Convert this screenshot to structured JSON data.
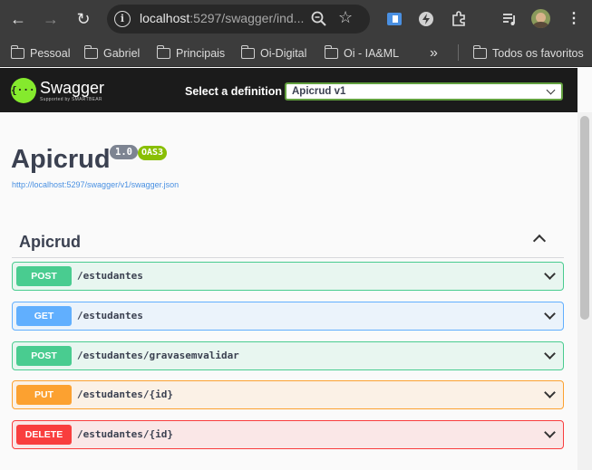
{
  "browser": {
    "url_host": "localhost",
    "url_rest": ":5297/swagger/ind...",
    "bookmarks": [
      {
        "label": "Pessoal"
      },
      {
        "label": "Gabriel"
      },
      {
        "label": "Principais"
      },
      {
        "label": "Oi-Digital"
      },
      {
        "label": "Oi - IA&ML"
      }
    ],
    "overflow_label": "»",
    "all_bookmarks_label": "Todos os favoritos"
  },
  "swagger": {
    "logo_text": "Swagger",
    "logo_sub": "Supported by SMARTBEAR",
    "logo_glyph": "{···}",
    "definition_label": "Select a definition",
    "definition_selected": "Apicrud v1"
  },
  "info": {
    "title": "Apicrud",
    "version": "1.0",
    "oas": "OAS3",
    "spec_url": "http://localhost:5297/swagger/v1/swagger.json"
  },
  "tag": {
    "name": "Apicrud"
  },
  "operations": [
    {
      "method": "POST",
      "path": "/estudantes"
    },
    {
      "method": "GET",
      "path": "/estudantes"
    },
    {
      "method": "POST",
      "path": "/estudantes/gravasemvalidar"
    },
    {
      "method": "PUT",
      "path": "/estudantes/{id}"
    },
    {
      "method": "DELETE",
      "path": "/estudantes/{id}"
    }
  ],
  "colors": {
    "post": "#49cc90",
    "get": "#61affe",
    "put": "#fca130",
    "delete": "#f93e3e",
    "swagger_green": "#85ea2d"
  }
}
